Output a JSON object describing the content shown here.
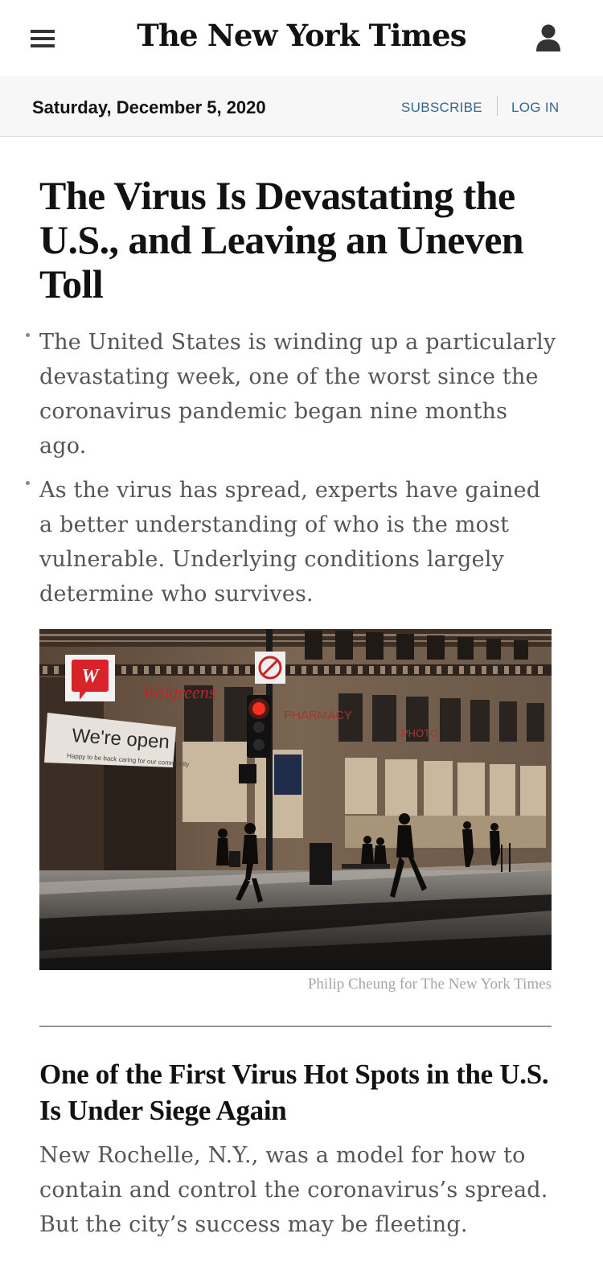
{
  "header": {
    "menu_icon": "hamburger-menu-icon",
    "logo": "The New York Times",
    "account_icon": "person-icon"
  },
  "datebar": {
    "date": "Saturday, December 5, 2020",
    "subscribe": "SUBSCRIBE",
    "login": "LOG IN",
    "link_color": "#326891"
  },
  "lead_story": {
    "headline": "The Virus Is Devastating the U.S., and Leaving an Uneven Toll",
    "summary": [
      "The United States is winding up a particularly devastating week, one of the worst since the coronavirus pandemic began nine months ago.",
      "As the virus has spread, experts have gained a better understanding of who is the most vulnerable. Underlying conditions largely determine who survives."
    ],
    "image": {
      "storefront_text": "Walgreens",
      "banner_text": "We're open",
      "banner_subtext": "Happy to be back caring for our community",
      "pharmacy_sign": "PHARMACY",
      "photo_sign": "PHOTO"
    },
    "credit": "Philip Cheung for The New York Times"
  },
  "second_story": {
    "headline": "One of the First Virus Hot Spots in the U.S. Is Under Siege Again",
    "summary": "New Rochelle, N.Y., was a model for how to contain and control the coronavirus’s spread. But the city’s success may be fleeting."
  }
}
